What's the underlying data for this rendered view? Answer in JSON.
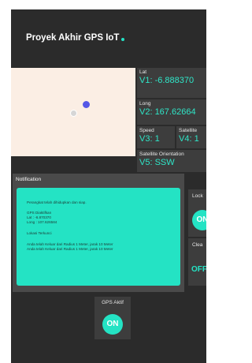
{
  "app": {
    "title": "Proyek Akhir GPS IoT"
  },
  "colors": {
    "accent": "#24e3c4",
    "background": "#2b2b2b",
    "tile": "#3d3d3d",
    "map": "#fbeee4",
    "current_location": "#5557e6"
  },
  "tiles": {
    "lat": {
      "label": "Lat",
      "value": "V1: -6.888370"
    },
    "long": {
      "label": "Long",
      "value": "V2: 167.62664"
    },
    "speed": {
      "label": "Speed",
      "value": "V3: 1"
    },
    "satellite": {
      "label": "Satellite",
      "value": "V4: 1"
    },
    "orientation": {
      "label": "Satellite Orientation",
      "value": "V5: SSW"
    }
  },
  "notification": {
    "title": "Notification",
    "lines": [
      "Perangkat telah dihidupkan dan siap.",
      "GPS Diaktifkan",
      "Lat : -6.870370",
      "Long : 107.626584",
      "Lokasi Terkunci",
      "Anda telah Keluar dari Radius 1 Meter, jarak 10 Meter",
      "Anda telah Keluar dari Radius 1 Meter, jarak 10 Meter"
    ]
  },
  "controls": {
    "lock": {
      "label": "Lock",
      "state": "ON"
    },
    "clear": {
      "label": "Clea",
      "state": "OFF"
    },
    "gps": {
      "label": "GPS Aktif",
      "state": "ON"
    }
  }
}
